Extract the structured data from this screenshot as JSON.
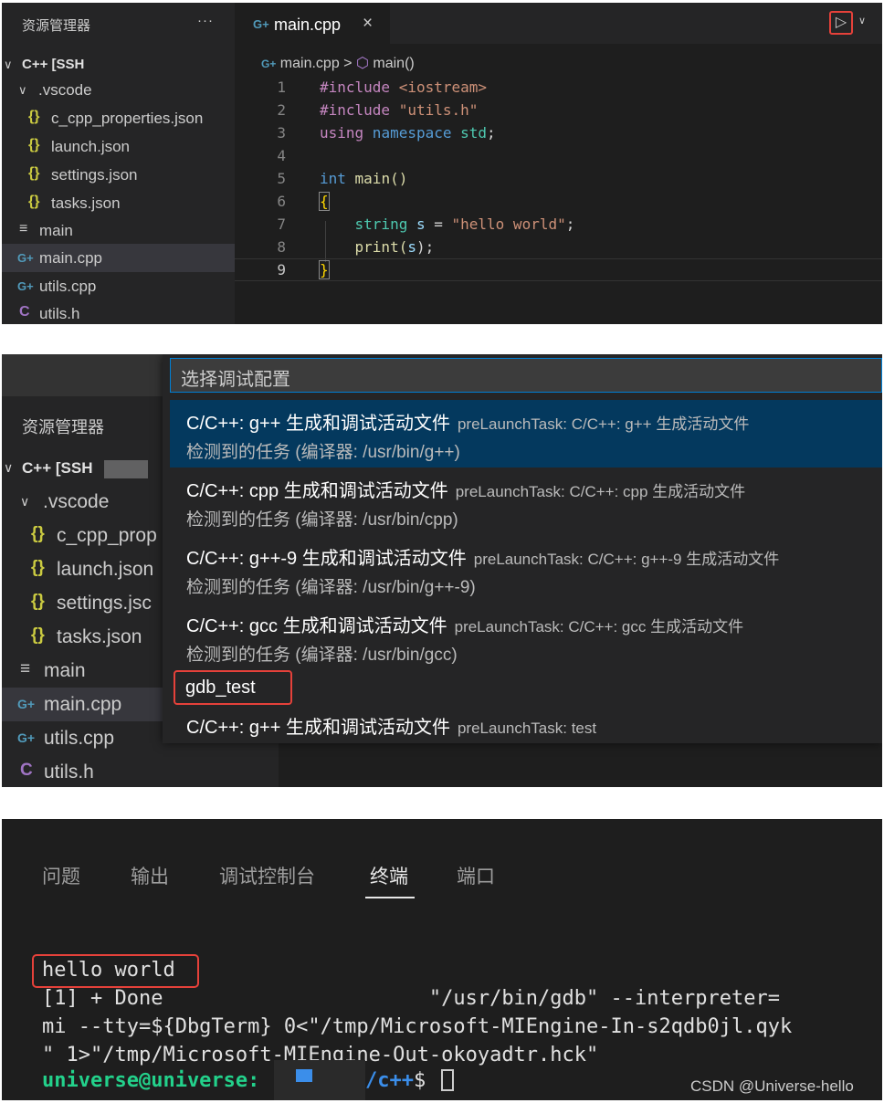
{
  "panel1": {
    "explorer_title": "资源管理器",
    "explorer_more": "···",
    "root_label": "C++ [SSH",
    "vscode_folder": ".vscode",
    "files": [
      {
        "icon": "{}",
        "name": "c_cpp_properties.json"
      },
      {
        "icon": "{}",
        "name": "launch.json"
      },
      {
        "icon": "{}",
        "name": "settings.json"
      },
      {
        "icon": "{}",
        "name": "tasks.json"
      },
      {
        "icon": "≡",
        "name": "main"
      },
      {
        "icon": "G+",
        "name": "main.cpp"
      },
      {
        "icon": "G+",
        "name": "utils.cpp"
      },
      {
        "icon": "C",
        "name": "utils.h"
      }
    ],
    "tab_label": "main.cpp",
    "tab_close": "×",
    "run_icon": "▷",
    "breadcrumb_file": "main.cpp",
    "breadcrumb_sep": ">",
    "breadcrumb_symbol": "main()",
    "line_numbers": [
      "1",
      "2",
      "3",
      "4",
      "5",
      "6",
      "7",
      "8",
      "9"
    ],
    "code": {
      "l1_a": "#include",
      "l1_b": " <iostream>",
      "l2_a": "#include",
      "l2_b": " \"utils.h\"",
      "l3_a": "using",
      "l3_b": " namespace",
      "l3_c": " std",
      "l3_d": ";",
      "l5_a": "int",
      "l5_b": " main",
      "l5_c": "()",
      "l6": "{",
      "l7_a": "    string",
      "l7_b": " s",
      "l7_c": " = ",
      "l7_d": "\"hello world\"",
      "l7_e": ";",
      "l8_a": "    print",
      "l8_b": "(",
      "l8_c": "s",
      "l8_d": ");",
      "l9": "}"
    }
  },
  "panel2": {
    "explorer_title": "资源管理器",
    "root_label": "C++ [SSH",
    "vscode_folder": ".vscode",
    "files": [
      {
        "icon": "{}",
        "name": "c_cpp_prop"
      },
      {
        "icon": "{}",
        "name": "launch.json"
      },
      {
        "icon": "{}",
        "name": "settings.jsc"
      },
      {
        "icon": "{}",
        "name": "tasks.json"
      },
      {
        "icon": "≡",
        "name": "main"
      },
      {
        "icon": "G+",
        "name": "main.cpp"
      },
      {
        "icon": "G+",
        "name": "utils.cpp"
      },
      {
        "icon": "C",
        "name": "utils.h"
      }
    ],
    "quick_pick_placeholder": "选择调试配置",
    "items": [
      {
        "title": "C/C++: g++ 生成和调试活动文件",
        "detail": "preLaunchTask: C/C++: g++ 生成活动文件",
        "sub": "检测到的任务 (编译器: /usr/bin/g++)"
      },
      {
        "title": "C/C++: cpp 生成和调试活动文件",
        "detail": "preLaunchTask: C/C++: cpp 生成活动文件",
        "sub": "检测到的任务 (编译器: /usr/bin/cpp)"
      },
      {
        "title": "C/C++: g++-9 生成和调试活动文件",
        "detail": "preLaunchTask: C/C++: g++-9 生成活动文件",
        "sub": "检测到的任务 (编译器: /usr/bin/g++-9)"
      },
      {
        "title": "C/C++: gcc 生成和调试活动文件",
        "detail": "preLaunchTask: C/C++: gcc 生成活动文件",
        "sub": "检测到的任务 (编译器: /usr/bin/gcc)"
      }
    ],
    "gdb_item": "gdb_test",
    "last_item_title": "C/C++: g++ 生成和调试活动文件",
    "last_item_detail": "preLaunchTask: test"
  },
  "panel3": {
    "tabs": [
      "问题",
      "输出",
      "调试控制台",
      "终端",
      "端口"
    ],
    "active_tab": "终端",
    "lines": [
      "hello world",
      "[1] + Done                      \"/usr/bin/gdb\" --interpreter=",
      "mi --tty=${DbgTerm} 0<\"/tmp/Microsoft-MIEngine-In-s2qdb0jl.qyk",
      "\" 1>\"/tmp/Microsoft-MIEngine-Out-okoyadtr.hck\""
    ],
    "prompt_user": "universe@universe:",
    "prompt_path": "/c++",
    "prompt_symbol": "$",
    "watermark": "CSDN @Universe-hello"
  },
  "colors": {
    "highlight_box": "#e5413a",
    "selection": "#04395e",
    "prompt_user": "#23d18b",
    "prompt_path": "#3b8eea"
  }
}
